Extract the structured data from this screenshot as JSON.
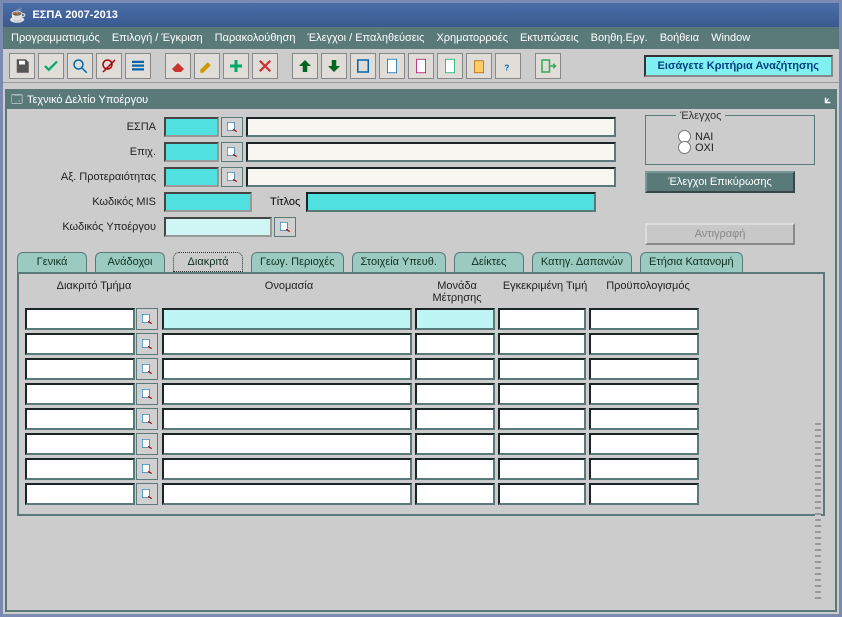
{
  "app": {
    "title": "ΕΣΠΑ 2007-2013"
  },
  "menu": {
    "items": [
      "Προγραμματισμός",
      "Επιλογή / Έγκριση",
      "Παρακολούθηση",
      "Έλεγχοι / Επαληθεύσεις",
      "Χρηματορροές",
      "Εκτυπώσεις",
      "Βοηθη.Εργ.",
      "Βοήθεια",
      "Window"
    ]
  },
  "status": {
    "search_hint": "Εισάγετε Κριτήρια Αναζήτησης"
  },
  "inner": {
    "title": "Τεχνικό Δελτίο Υποέργου"
  },
  "form": {
    "espa_label": "ΕΣΠΑ",
    "epix_label": "Επιχ.",
    "axis_label": "Αξ. Προτεραιότητας",
    "mis_label": "Κωδικός MIS",
    "title_label": "Τίτλος",
    "subproject_label": "Κωδικός Υποέργου"
  },
  "control": {
    "legend": "Έλεγχος",
    "yes": "ΝΑΙ",
    "no": "ΟΧΙ",
    "validate_btn": "Έλεγχοι Επικύρωσης",
    "copy_btn": "Αντιγραφή"
  },
  "tabs": {
    "list": [
      "Γενικά",
      "Ανάδοχοι",
      "Διακριτά",
      "Γεωγ. Περιοχές",
      "Στοιχεία Υπευθ.",
      "Δείκτες",
      "Κατηγ. Δαπανών",
      "Ετήσια Κατανομή"
    ],
    "active_index": 2
  },
  "grid": {
    "headers": {
      "section": "Διακριτό Τμήμα",
      "name": "Ονομασία",
      "unit": "Μονάδα Μέτρησης",
      "approved": "Εγκεκριμένη Τιμή",
      "budget": "Προϋπολογισμός"
    },
    "rows": 8
  }
}
